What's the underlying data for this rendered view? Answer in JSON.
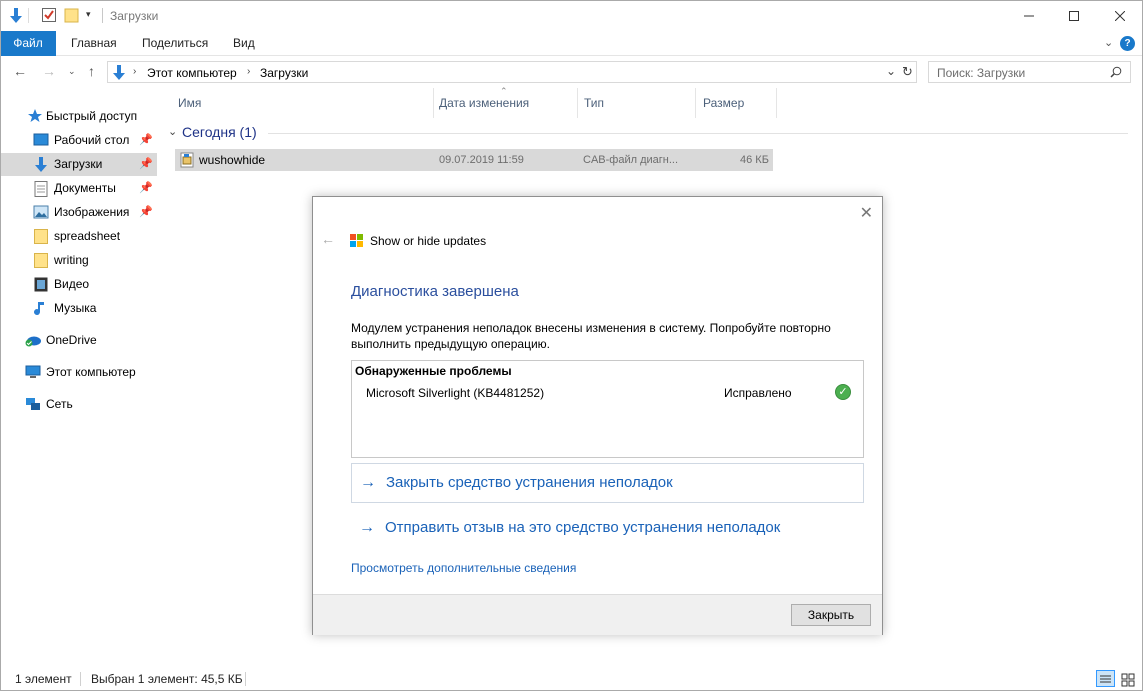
{
  "window": {
    "title": "Загрузки",
    "minimize_icon": "minimize-icon",
    "maximize_icon": "maximize-icon",
    "close_icon": "close-icon"
  },
  "ribbon": {
    "tabs": [
      "Файл",
      "Главная",
      "Поделиться",
      "Вид"
    ],
    "help": "?"
  },
  "address": {
    "crumbs": [
      "Этот компьютер",
      "Загрузки"
    ],
    "search_placeholder": "Поиск: Загрузки"
  },
  "nav": {
    "quick_access": "Быстрый доступ",
    "items": [
      {
        "label": "Рабочий стол",
        "icon": "desktop-icon",
        "pinned": true
      },
      {
        "label": "Загрузки",
        "icon": "downloads-icon",
        "pinned": true,
        "selected": true
      },
      {
        "label": "Документы",
        "icon": "documents-icon",
        "pinned": true
      },
      {
        "label": "Изображения",
        "icon": "pictures-icon",
        "pinned": true
      },
      {
        "label": "spreadsheet",
        "icon": "folder-icon",
        "pinned": false
      },
      {
        "label": "writing",
        "icon": "folder-icon",
        "pinned": false
      },
      {
        "label": "Видео",
        "icon": "video-icon",
        "pinned": false
      },
      {
        "label": "Музыка",
        "icon": "music-icon",
        "pinned": false
      }
    ],
    "onedrive": "OneDrive",
    "this_pc": "Этот компьютер",
    "network": "Сеть"
  },
  "files": {
    "columns": [
      "Имя",
      "Дата изменения",
      "Тип",
      "Размер"
    ],
    "group": "Сегодня (1)",
    "rows": [
      {
        "name": "wushowhide",
        "date": "09.07.2019 11:59",
        "type": "CAB-файл диагн...",
        "size": "46 КБ"
      }
    ]
  },
  "status": {
    "count": "1 элемент",
    "selection": "Выбран 1 элемент: 45,5 КБ"
  },
  "dialog": {
    "app_name": "Show or hide updates",
    "heading": "Диагностика завершена",
    "description": "Модулем устранения неполадок внесены изменения в систему. Попробуйте повторно выполнить предыдущую операцию.",
    "problems_title": "Обнаруженные проблемы",
    "problem_name": "Microsoft Silverlight (KB4481252)",
    "problem_status": "Исправлено",
    "action_close": "Закрыть средство устранения неполадок",
    "action_feedback": "Отправить отзыв на это средство устранения неполадок",
    "more_info": "Просмотреть дополнительные сведения",
    "close_button": "Закрыть"
  },
  "colors": {
    "accent": "#1979ca",
    "link": "#1a62b8",
    "selection": "#d9d9d9",
    "success": "#4caf50"
  }
}
